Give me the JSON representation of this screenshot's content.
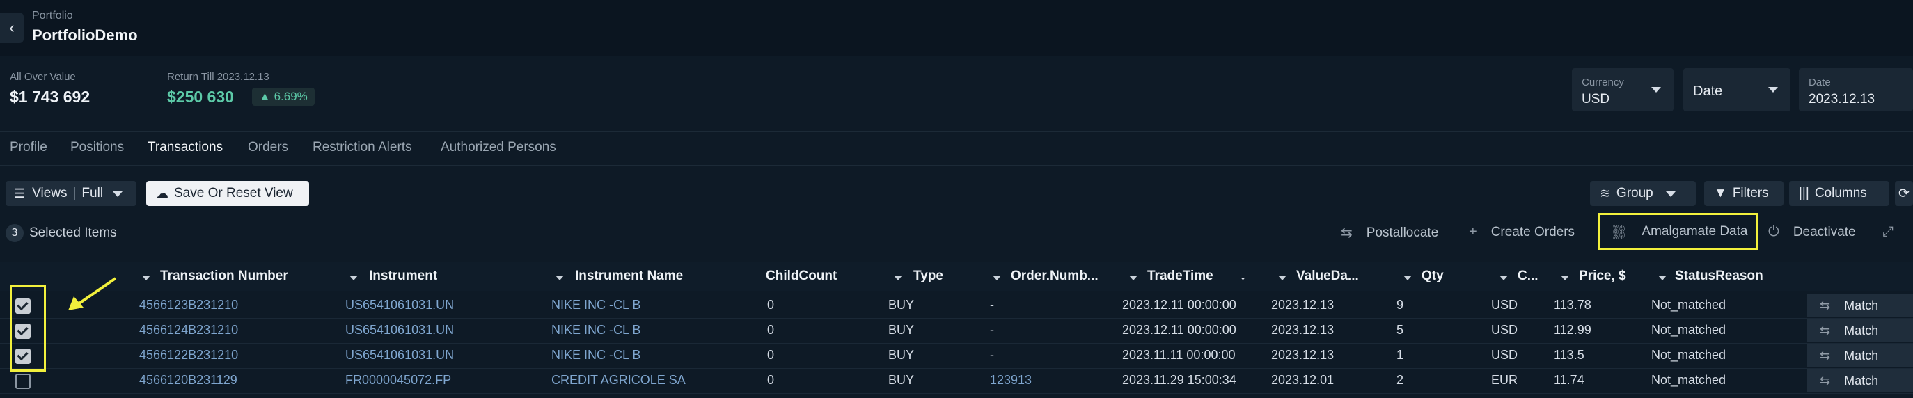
{
  "header": {
    "breadcrumb": "Portfolio",
    "title": "PortfolioDemo"
  },
  "kpis": {
    "allover_label": "All Over Value",
    "allover_value": "$1 743 692",
    "return_label": "Return Till 2023.12.13",
    "return_value": "$250 630",
    "return_pct": "6.69%"
  },
  "selectors": {
    "currency_label": "Currency",
    "currency_value": "USD",
    "date_mode_value": "Date",
    "date_label": "Date",
    "date_value": "2023.12.13"
  },
  "tabs": [
    {
      "label": "Profile"
    },
    {
      "label": "Positions"
    },
    {
      "label": "Transactions"
    },
    {
      "label": "Orders"
    },
    {
      "label": "Restriction Alerts"
    },
    {
      "label": "Authorized Persons"
    }
  ],
  "active_tab": "Transactions",
  "toolbar": {
    "views_label": "Views",
    "views_value": "Full",
    "save_reset": "Save Or Reset View",
    "group": "Group",
    "filters": "Filters",
    "columns": "Columns"
  },
  "selection": {
    "count": "3",
    "label": "Selected Items"
  },
  "actions": {
    "postallocate": "Postallocate",
    "create_orders": "Create Orders",
    "amalgamate": "Amalgamate Data",
    "deactivate": "Deactivate"
  },
  "table": {
    "columns": [
      "Transaction Number",
      "Instrument",
      "Instrument Name",
      "ChildCount",
      "Type",
      "Order.Numb...",
      "TradeTime",
      "ValueDa...",
      "Qty",
      "C...",
      "Price, $",
      "StatusReason"
    ],
    "match_label": "Match",
    "rows": [
      {
        "checked": true,
        "cells": [
          "4566123B231210",
          "US6541061031.UN",
          "NIKE INC -CL B",
          "0",
          "BUY",
          "-",
          "2023.12.11 00:00:00",
          "2023.12.13",
          "9",
          "USD",
          "113.78",
          "Not_matched"
        ]
      },
      {
        "checked": true,
        "cells": [
          "4566124B231210",
          "US6541061031.UN",
          "NIKE INC -CL B",
          "0",
          "BUY",
          "-",
          "2023.12.11 00:00:00",
          "2023.12.13",
          "5",
          "USD",
          "112.99",
          "Not_matched"
        ]
      },
      {
        "checked": true,
        "cells": [
          "4566122B231210",
          "US6541061031.UN",
          "NIKE INC -CL B",
          "0",
          "BUY",
          "-",
          "2023.11.11 00:00:00",
          "2023.12.13",
          "1",
          "USD",
          "113.5",
          "Not_matched"
        ]
      },
      {
        "checked": false,
        "cells": [
          "4566120B231129",
          "FR0000045072.FP",
          "CREDIT AGRICOLE SA",
          "0",
          "BUY",
          "123913",
          "2023.11.29 15:00:34",
          "2023.12.01",
          "2",
          "EUR",
          "11.74",
          "Not_matched"
        ]
      }
    ]
  },
  "colors": {
    "background": "#0e1a26",
    "accent_green": "#5cc9a7",
    "highlight": "#f2f03c"
  }
}
